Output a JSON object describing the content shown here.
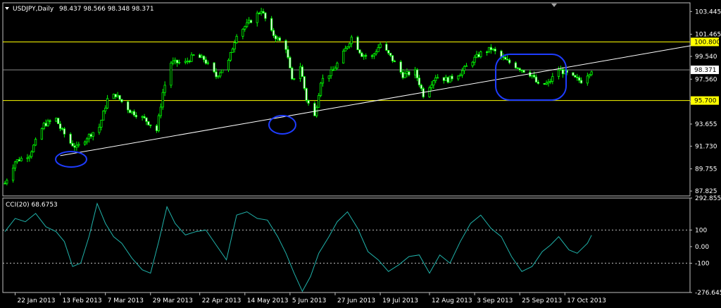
{
  "chart_data": [
    {
      "type": "candlestick",
      "title": "USDJPY,Daily",
      "ohlc_label": "98.437 98.566 98.348 98.371",
      "current_price": 98.371,
      "ylim": [
        87.4,
        104.2
      ],
      "y_ticks": [
        "103.445",
        "101.465",
        "99.540",
        "97.560",
        "95.635",
        "93.655",
        "91.730",
        "89.755",
        "87.825"
      ],
      "horizontal_levels": [
        {
          "label": "100.800",
          "value": 100.8,
          "color": "#ffff00"
        },
        {
          "label": "95.700",
          "value": 95.7,
          "color": "#ffff00"
        }
      ],
      "current_price_label": "98.371",
      "trendline": {
        "start": [
          "13 Feb 2013",
          90.9
        ],
        "end": [
          "28 Oct 2013",
          98.9
        ],
        "color": "#ffffff"
      },
      "highlights": [
        "ellipse",
        "ellipse",
        "rounded-rect"
      ],
      "x_ticks": [
        "22 Jan 2013",
        "13 Feb 2013",
        "7 Mar 2013",
        "29 Mar 2013",
        "22 Apr 2013",
        "14 May 2013",
        "5 Jun 2013",
        "27 Jun 2013",
        "19 Jul 2013",
        "12 Aug 2013",
        "3 Sep 2013",
        "25 Sep 2013",
        "17 Oct 2013"
      ],
      "close_path": [
        [
          "2013-01-17",
          88.5
        ],
        [
          "2013-01-22",
          90.4
        ],
        [
          "2013-01-29",
          91.0
        ],
        [
          "2013-02-05",
          93.6
        ],
        [
          "2013-02-11",
          94.1
        ],
        [
          "2013-02-13",
          93.3
        ],
        [
          "2013-02-18",
          92.0
        ],
        [
          "2013-02-21",
          91.6
        ],
        [
          "2013-02-26",
          92.5
        ],
        [
          "2013-03-04",
          93.4
        ],
        [
          "2013-03-08",
          95.8
        ],
        [
          "2013-03-12",
          96.2
        ],
        [
          "2013-03-19",
          94.8
        ],
        [
          "2013-03-26",
          94.1
        ],
        [
          "2013-04-01",
          93.1
        ],
        [
          "2013-04-04",
          96.4
        ],
        [
          "2013-04-08",
          99.0
        ],
        [
          "2013-04-15",
          99.0
        ],
        [
          "2013-04-19",
          99.6
        ],
        [
          "2013-04-24",
          99.3
        ],
        [
          "2013-04-30",
          97.8
        ],
        [
          "2013-05-06",
          99.1
        ],
        [
          "2013-05-10",
          101.5
        ],
        [
          "2013-05-15",
          102.3
        ],
        [
          "2013-05-20",
          103.2
        ],
        [
          "2013-05-22",
          103.6
        ],
        [
          "2013-05-27",
          101.6
        ],
        [
          "2013-06-03",
          100.3
        ],
        [
          "2013-06-06",
          97.4
        ],
        [
          "2013-06-10",
          98.7
        ],
        [
          "2013-06-13",
          95.8
        ],
        [
          "2013-06-17",
          94.3
        ],
        [
          "2013-06-20",
          97.4
        ],
        [
          "2013-06-26",
          98.3
        ],
        [
          "2013-07-01",
          99.8
        ],
        [
          "2013-07-05",
          101.2
        ],
        [
          "2013-07-10",
          99.7
        ],
        [
          "2013-07-15",
          99.5
        ],
        [
          "2013-07-19",
          100.6
        ],
        [
          "2013-07-24",
          99.5
        ],
        [
          "2013-07-30",
          97.9
        ],
        [
          "2013-08-05",
          98.2
        ],
        [
          "2013-08-09",
          96.2
        ],
        [
          "2013-08-15",
          97.8
        ],
        [
          "2013-08-21",
          97.5
        ],
        [
          "2013-08-27",
          98.1
        ],
        [
          "2013-09-02",
          99.2
        ],
        [
          "2013-09-06",
          99.8
        ],
        [
          "2013-09-11",
          100.2
        ],
        [
          "2013-09-18",
          99.2
        ],
        [
          "2013-09-24",
          98.6
        ],
        [
          "2013-10-01",
          97.9
        ],
        [
          "2013-10-04",
          97.0
        ],
        [
          "2013-10-09",
          97.2
        ],
        [
          "2013-10-14",
          98.4
        ],
        [
          "2013-10-18",
          98.0
        ],
        [
          "2013-10-22",
          97.6
        ],
        [
          "2013-10-25",
          97.4
        ],
        [
          "2013-10-28",
          98.0
        ],
        [
          "2013-10-30",
          98.37
        ]
      ]
    },
    {
      "type": "line",
      "title": "CCI(20) 68.6753",
      "ylim": [
        -276.6458,
        292.8552
      ],
      "y_ticks": [
        "292.8552",
        "100",
        "0.00",
        "-100",
        "-276.6458"
      ],
      "reference_levels": [
        100,
        -100
      ],
      "line_color": "#20b2aa",
      "series": [
        {
          "x": [
            "2013-01-17",
            "2013-01-22",
            "2013-01-27",
            "2013-02-01",
            "2013-02-06",
            "2013-02-11",
            "2013-02-15",
            "2013-02-19",
            "2013-02-23",
            "2013-02-27",
            "2013-03-03",
            "2013-03-07",
            "2013-03-11",
            "2013-03-15",
            "2013-03-20",
            "2013-03-25",
            "2013-03-29",
            "2013-04-02",
            "2013-04-06",
            "2013-04-10",
            "2013-04-15",
            "2013-04-20",
            "2013-04-25",
            "2013-04-30",
            "2013-05-05",
            "2013-05-10",
            "2013-05-15",
            "2013-05-20",
            "2013-05-25",
            "2013-05-30",
            "2013-06-03",
            "2013-06-07",
            "2013-06-11",
            "2013-06-15",
            "2013-06-19",
            "2013-06-24",
            "2013-06-28",
            "2013-07-03",
            "2013-07-08",
            "2013-07-13",
            "2013-07-18",
            "2013-07-23",
            "2013-07-28",
            "2013-08-02",
            "2013-08-07",
            "2013-08-12",
            "2013-08-17",
            "2013-08-22",
            "2013-08-27",
            "2013-09-01",
            "2013-09-06",
            "2013-09-11",
            "2013-09-16",
            "2013-09-21",
            "2013-09-26",
            "2013-10-01",
            "2013-10-06",
            "2013-10-10",
            "2013-10-14",
            "2013-10-19",
            "2013-10-23",
            "2013-10-28",
            "2013-10-30"
          ],
          "values": [
            90,
            170,
            150,
            200,
            120,
            90,
            30,
            -120,
            -100,
            60,
            260,
            140,
            60,
            20,
            -70,
            -140,
            -160,
            30,
            240,
            140,
            70,
            90,
            100,
            10,
            -80,
            190,
            210,
            170,
            160,
            60,
            -40,
            -160,
            -270,
            -180,
            -40,
            60,
            150,
            210,
            110,
            -30,
            -80,
            -150,
            -110,
            -60,
            -50,
            -160,
            -50,
            -100,
            30,
            140,
            190,
            110,
            60,
            -60,
            -150,
            -120,
            -30,
            10,
            60,
            -20,
            -40,
            20,
            69
          ]
        }
      ]
    }
  ]
}
